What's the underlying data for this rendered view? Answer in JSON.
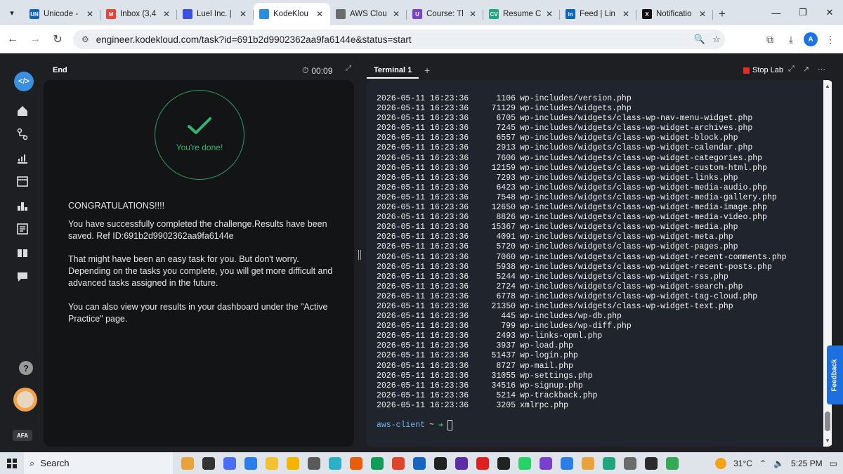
{
  "browser": {
    "tabs": [
      {
        "label": "Unicode -",
        "icon": "unicode-favicon",
        "color": "#1565c0",
        "icon_text": "UN"
      },
      {
        "label": "Inbox (3,4",
        "icon": "gmail-favicon",
        "color": "#ea4335",
        "icon_text": "M"
      },
      {
        "label": "Luel Inc. |",
        "icon": "luel-favicon",
        "color": "#3b4fe0",
        "icon_text": ""
      },
      {
        "label": "KodeKlou",
        "icon": "kodekloud-favicon",
        "color": "#2a8de0",
        "icon_text": "",
        "active": true
      },
      {
        "label": "AWS Clou",
        "icon": "chatgpt-favicon",
        "color": "#6b6b6b",
        "icon_text": ""
      },
      {
        "label": "Course: Tl",
        "icon": "course-favicon",
        "color": "#7a3fd0",
        "icon_text": "U"
      },
      {
        "label": "Resume C",
        "icon": "resume-favicon",
        "color": "#1fa67a",
        "icon_text": "CV"
      },
      {
        "label": "Feed | Lin",
        "icon": "linkedin-favicon",
        "color": "#0a66c2",
        "icon_text": "in"
      },
      {
        "label": "Notificatio",
        "icon": "x-favicon",
        "color": "#111111",
        "icon_text": "X"
      }
    ],
    "address": {
      "url": "engineer.kodekloud.com/task?id=691b2d9902362aa9fa6144e&status=start"
    },
    "profile_initial": "A"
  },
  "task": {
    "header_label": "End",
    "timer": "00:09",
    "done_text": "You're done!",
    "congrats": "CONGRATULATIONS!!!!",
    "completed_msg": "You have successfully completed the challenge.Results have been saved. Ref ID:691b2d9902362aa9fa6144e",
    "easy_msg": "That might have been an easy task for you. But don't worry. Depending on the tasks you complete, you will get more difficult and advanced tasks assigned in the future.",
    "dashboard_msg": "You can also view your results in your dashboard under the \"Active Practice\" page."
  },
  "terminal": {
    "tab_label": "Terminal 1",
    "stop_lab": "Stop Lab",
    "lines": [
      {
        "ts": "2026-05-11 16:23:36",
        "size": "1106",
        "file": "wp-includes/version.php"
      },
      {
        "ts": "2026-05-11 16:23:36",
        "size": "71129",
        "file": "wp-includes/widgets.php"
      },
      {
        "ts": "2026-05-11 16:23:36",
        "size": "6705",
        "file": "wp-includes/widgets/class-wp-nav-menu-widget.php"
      },
      {
        "ts": "2026-05-11 16:23:36",
        "size": "7245",
        "file": "wp-includes/widgets/class-wp-widget-archives.php"
      },
      {
        "ts": "2026-05-11 16:23:36",
        "size": "6557",
        "file": "wp-includes/widgets/class-wp-widget-block.php"
      },
      {
        "ts": "2026-05-11 16:23:36",
        "size": "2913",
        "file": "wp-includes/widgets/class-wp-widget-calendar.php"
      },
      {
        "ts": "2026-05-11 16:23:36",
        "size": "7606",
        "file": "wp-includes/widgets/class-wp-widget-categories.php"
      },
      {
        "ts": "2026-05-11 16:23:36",
        "size": "12159",
        "file": "wp-includes/widgets/class-wp-widget-custom-html.php"
      },
      {
        "ts": "2026-05-11 16:23:36",
        "size": "7293",
        "file": "wp-includes/widgets/class-wp-widget-links.php"
      },
      {
        "ts": "2026-05-11 16:23:36",
        "size": "6423",
        "file": "wp-includes/widgets/class-wp-widget-media-audio.php"
      },
      {
        "ts": "2026-05-11 16:23:36",
        "size": "7548",
        "file": "wp-includes/widgets/class-wp-widget-media-gallery.php"
      },
      {
        "ts": "2026-05-11 16:23:36",
        "size": "12650",
        "file": "wp-includes/widgets/class-wp-widget-media-image.php"
      },
      {
        "ts": "2026-05-11 16:23:36",
        "size": "8826",
        "file": "wp-includes/widgets/class-wp-widget-media-video.php"
      },
      {
        "ts": "2026-05-11 16:23:36",
        "size": "15367",
        "file": "wp-includes/widgets/class-wp-widget-media.php"
      },
      {
        "ts": "2026-05-11 16:23:36",
        "size": "4091",
        "file": "wp-includes/widgets/class-wp-widget-meta.php"
      },
      {
        "ts": "2026-05-11 16:23:36",
        "size": "5720",
        "file": "wp-includes/widgets/class-wp-widget-pages.php"
      },
      {
        "ts": "2026-05-11 16:23:36",
        "size": "7060",
        "file": "wp-includes/widgets/class-wp-widget-recent-comments.php"
      },
      {
        "ts": "2026-05-11 16:23:36",
        "size": "5938",
        "file": "wp-includes/widgets/class-wp-widget-recent-posts.php"
      },
      {
        "ts": "2026-05-11 16:23:36",
        "size": "5244",
        "file": "wp-includes/widgets/class-wp-widget-rss.php"
      },
      {
        "ts": "2026-05-11 16:23:36",
        "size": "2724",
        "file": "wp-includes/widgets/class-wp-widget-search.php"
      },
      {
        "ts": "2026-05-11 16:23:36",
        "size": "6778",
        "file": "wp-includes/widgets/class-wp-widget-tag-cloud.php"
      },
      {
        "ts": "2026-05-11 16:23:36",
        "size": "21350",
        "file": "wp-includes/widgets/class-wp-widget-text.php"
      },
      {
        "ts": "2026-05-11 16:23:36",
        "size": "445",
        "file": "wp-includes/wp-db.php"
      },
      {
        "ts": "2026-05-11 16:23:36",
        "size": "799",
        "file": "wp-includes/wp-diff.php"
      },
      {
        "ts": "2026-05-11 16:23:36",
        "size": "2493",
        "file": "wp-links-opml.php"
      },
      {
        "ts": "2026-05-11 16:23:36",
        "size": "3937",
        "file": "wp-load.php"
      },
      {
        "ts": "2026-05-11 16:23:36",
        "size": "51437",
        "file": "wp-login.php"
      },
      {
        "ts": "2026-05-11 16:23:36",
        "size": "8727",
        "file": "wp-mail.php"
      },
      {
        "ts": "2026-05-11 16:23:36",
        "size": "31055",
        "file": "wp-settings.php"
      },
      {
        "ts": "2026-05-11 16:23:36",
        "size": "34516",
        "file": "wp-signup.php"
      },
      {
        "ts": "2026-05-11 16:23:36",
        "size": "5214",
        "file": "wp-trackback.php"
      },
      {
        "ts": "2026-05-11 16:23:36",
        "size": "3205",
        "file": "xmlrpc.php"
      }
    ],
    "prompt_host": "aws-client",
    "prompt_dir": "~"
  },
  "sidebar": {
    "badge": "AFA"
  },
  "feedback_label": "Feedback",
  "taskbar": {
    "search_label": "Search",
    "temperature": "31°C",
    "time": "5:25 PM",
    "apps": [
      "#e8a33d",
      "#333333",
      "#4a6cf7",
      "#2b7de9",
      "#f2c230",
      "#f5b400",
      "#5a5a5a",
      "#2bb0c8",
      "#e85d0c",
      "#0f9d58",
      "#e0442a",
      "#1565c0",
      "#222222",
      "#5b2ea6",
      "#e02020",
      "#222222",
      "#25d366",
      "#7a3fd0",
      "#2b7de9",
      "#e8a33d",
      "#1fa67a",
      "#6b6b6b",
      "#2b2b2b",
      "#34a853"
    ]
  }
}
